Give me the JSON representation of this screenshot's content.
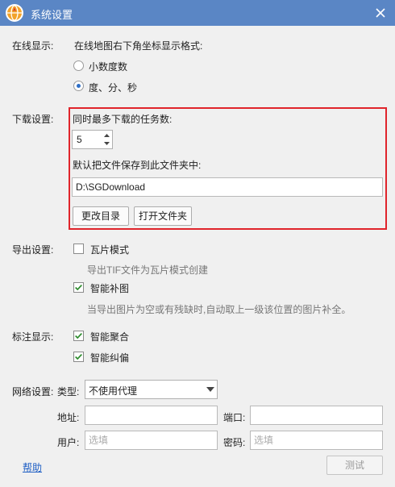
{
  "window": {
    "title": "系统设置",
    "app_icon": "globe-icon",
    "close_icon": "close-icon",
    "accent": "#5a86c5"
  },
  "online_display": {
    "section_label": "在线显示:",
    "description": "在线地图右下角坐标显示格式:",
    "options": [
      "小数度数",
      "度、分、秒"
    ],
    "selected": "度、分、秒"
  },
  "download": {
    "section_label": "下载设置:",
    "max_tasks_label": "同时最多下载的任务数:",
    "max_tasks_value": "5",
    "folder_label": "默认把文件保存到此文件夹中:",
    "folder_value": "D:\\SGDownload",
    "change_dir_button": "更改目录",
    "open_folder_button": "打开文件夹",
    "highlight_color": "#e0242b"
  },
  "export": {
    "section_label": "导出设置:",
    "tile_mode_label": "瓦片模式",
    "tile_mode_checked": false,
    "tile_mode_hint": "导出TIF文件为瓦片模式创建",
    "smart_fill_label": "智能补图",
    "smart_fill_checked": true,
    "smart_fill_hint": "当导出图片为空或有残缺时,自动取上一级该位置的图片补全。"
  },
  "annotation": {
    "section_label": "标注显示:",
    "smart_merge_label": "智能聚合",
    "smart_merge_checked": true,
    "smart_correct_label": "智能纠偏",
    "smart_correct_checked": true
  },
  "network": {
    "section_label": "网络设置:",
    "type_label": "类型:",
    "type_value": "不使用代理",
    "address_label": "地址:",
    "address_value": "",
    "port_label": "端口:",
    "port_value": "",
    "user_label": "用户:",
    "user_placeholder": "选填",
    "password_label": "密码:",
    "password_placeholder": "选填"
  },
  "footer": {
    "help_link": "帮助",
    "test_button": "测试"
  }
}
